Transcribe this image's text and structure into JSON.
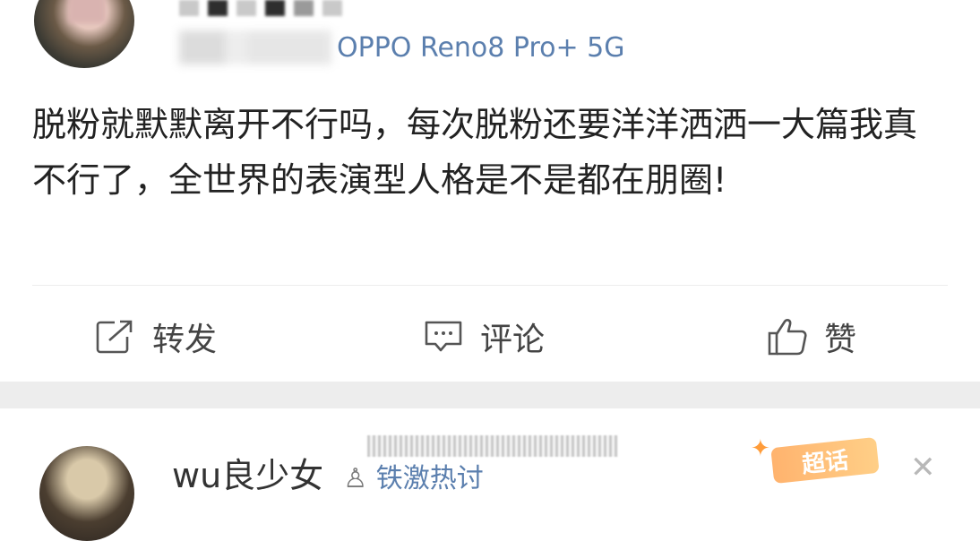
{
  "post1": {
    "source_text": "OPPO Reno8 Pro+ 5G",
    "body": "脱粉就默默离开不行吗，每次脱粉还要洋洋洒洒一大篇我真不行了，全世界的表演型人格是不是都在朋圈!",
    "actions": {
      "repost": "转发",
      "comment": "评论",
      "like": "赞"
    }
  },
  "post2": {
    "username": "wu良少女",
    "badge_icon": "user-icon",
    "badge_text": "铁激热讨",
    "super_tag": "超话"
  },
  "colors": {
    "link": "#5b7fae",
    "text": "#222222",
    "separator": "#ededed"
  }
}
